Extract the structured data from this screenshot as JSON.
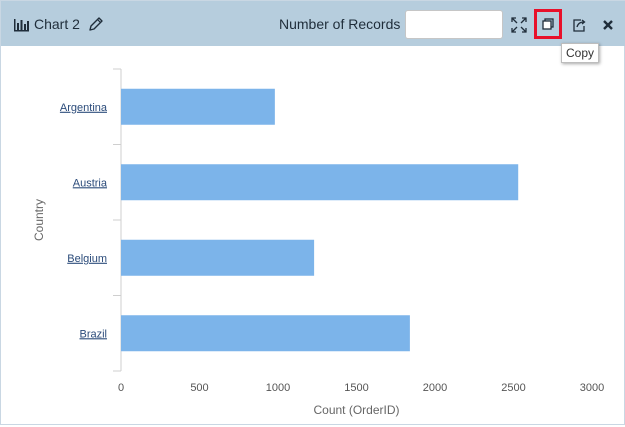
{
  "header": {
    "title": "Chart 2",
    "records_label": "Number of Records",
    "records_value": "",
    "tooltip": "Copy"
  },
  "icons": {
    "chart": "bar-chart-icon",
    "edit": "pencil-icon",
    "expand": "expand-icon",
    "copy": "copy-icon",
    "export": "export-icon",
    "close": "close-icon"
  },
  "colors": {
    "header_bg": "#b6cddd",
    "bar": "#7cb4ea",
    "highlight": "#e8102a"
  },
  "chart_data": {
    "type": "bar",
    "orientation": "horizontal",
    "categories": [
      "Argentina",
      "Austria",
      "Belgium",
      "Brazil"
    ],
    "values": [
      980,
      2530,
      1230,
      1840
    ],
    "xlabel": "Count (OrderID)",
    "ylabel": "Country",
    "xlim": [
      0,
      3000
    ],
    "xticks": [
      0,
      500,
      1000,
      1500,
      2000,
      2500,
      3000
    ],
    "grid": false
  }
}
